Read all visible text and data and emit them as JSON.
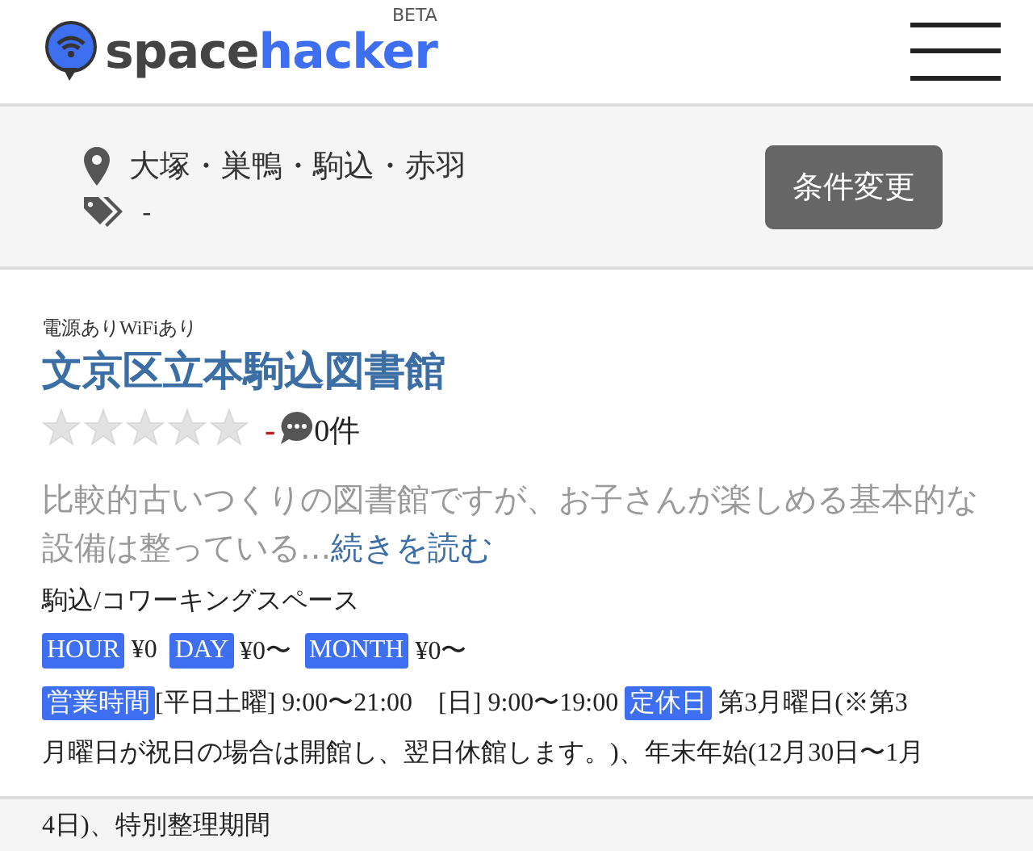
{
  "header": {
    "logo_dark": "space",
    "logo_blue": "hacker",
    "badge": "BETA"
  },
  "filter": {
    "area": "大塚・巣鴨・駒込・赤羽",
    "tags": "-",
    "button": "条件変更"
  },
  "listing": {
    "features": "電源ありWiFiあり",
    "title": "文京区立本駒込図書館",
    "stars": 0,
    "rating": "-",
    "comments": "0件",
    "description": "比較的古いつくりの図書館ですが、お子さんが楽しめる基本的な設備は整っている...",
    "more_link": "続きを読む",
    "category": "駒込/コワーキングスペース",
    "prices": [
      {
        "label": "HOUR",
        "value": "¥0"
      },
      {
        "label": "DAY",
        "value": "¥0〜"
      },
      {
        "label": "MONTH",
        "value": "¥0〜"
      }
    ],
    "hours_label": "営業時間",
    "hours": "[平日土曜] 9:00〜21:00　[日] 9:00〜19:00",
    "closed_label": "定休日",
    "closed_lines": [
      "第3月曜日(※第3",
      "月曜日が祝日の場合は開館し、翌日休館します。)、年末年始(12月30日〜1月"
    ]
  },
  "footer": {
    "text": "4日)、特別整理期間"
  }
}
